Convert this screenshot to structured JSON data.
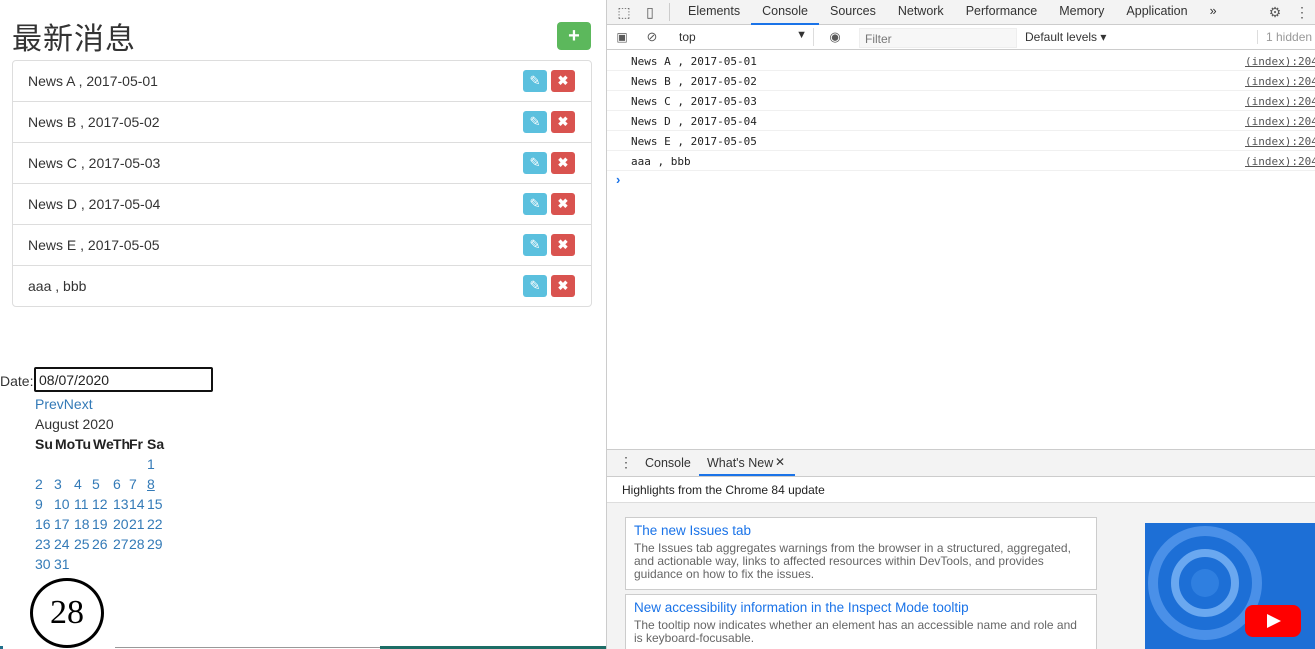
{
  "page": {
    "title": "最新消息",
    "add_button": "+",
    "news": [
      {
        "text": "News A , 2017-05-01"
      },
      {
        "text": "News B , 2017-05-02"
      },
      {
        "text": "News C , 2017-05-03"
      },
      {
        "text": "News D , 2017-05-04"
      },
      {
        "text": "News E , 2017-05-05"
      },
      {
        "text": "aaa , bbb"
      }
    ],
    "edit_icon": "✎",
    "delete_icon": "✖",
    "date_label": "Date:",
    "date_value": "08/07/2020",
    "calendar": {
      "prev": "Prev",
      "next": "Next",
      "month": "August 2020",
      "weekdays": [
        "Su",
        "Mo",
        "Tu",
        "We",
        "Th",
        "Fr",
        "Sa"
      ],
      "weeks": [
        [
          "",
          "",
          "",
          "",
          "",
          "",
          "1"
        ],
        [
          "2",
          "3",
          "4",
          "5",
          "6",
          "7",
          "8"
        ],
        [
          "9",
          "10",
          "11",
          "12",
          "13",
          "14",
          "15"
        ],
        [
          "16",
          "17",
          "18",
          "19",
          "20",
          "21",
          "22"
        ],
        [
          "23",
          "24",
          "25",
          "26",
          "27",
          "28",
          "29"
        ],
        [
          "30",
          "31",
          "",
          "",
          "",
          "",
          ""
        ]
      ],
      "selected": "8"
    },
    "badge": "28"
  },
  "devtools": {
    "tabs": [
      "Elements",
      "Console",
      "Sources",
      "Network",
      "Performance",
      "Memory",
      "Application"
    ],
    "active_tab": "Console",
    "more_tabs": "»",
    "context": "top",
    "filter_placeholder": "Filter",
    "levels": "Default levels ▾",
    "hidden": "1 hidden",
    "console_lines": [
      {
        "msg": "News A , 2017-05-01",
        "src": "(index):204"
      },
      {
        "msg": "News B , 2017-05-02",
        "src": "(index):204"
      },
      {
        "msg": "News C , 2017-05-03",
        "src": "(index):204"
      },
      {
        "msg": "News D , 2017-05-04",
        "src": "(index):204"
      },
      {
        "msg": "News E , 2017-05-05",
        "src": "(index):204"
      },
      {
        "msg": "aaa , bbb",
        "src": "(index):204"
      }
    ],
    "prompt": "›",
    "drawer": {
      "tabs": [
        "Console",
        "What's New"
      ],
      "close": "✕",
      "highlights": "Highlights from the Chrome 84 update",
      "cards": [
        {
          "title": "The new Issues tab",
          "desc": "The Issues tab aggregates warnings from the browser in a structured, aggregated, and actionable way, links to affected resources within DevTools, and provides guidance on how to fix the issues."
        },
        {
          "title": "New accessibility information in the Inspect Mode tooltip",
          "desc": "The tooltip now indicates whether an element has an accessible name and role and is keyboard-focusable."
        }
      ]
    },
    "colors": {
      "accent": "#1a73e8",
      "success": "#5cb85c",
      "info": "#5bc0de",
      "danger": "#d9534f"
    }
  }
}
